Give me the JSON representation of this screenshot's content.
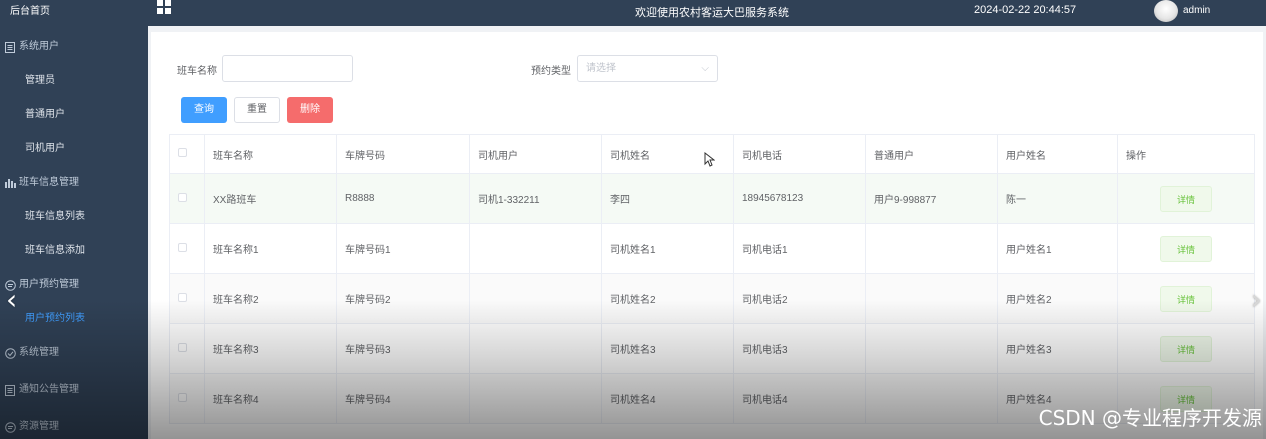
{
  "sidebar": {
    "home": "后台首页",
    "groups": [
      {
        "label": "系统用户",
        "icon": "document-icon"
      },
      {
        "label": "班车信息管理",
        "icon": "bar-chart-icon"
      },
      {
        "label": "用户预约管理",
        "icon": "chat-icon"
      },
      {
        "label": "系统管理",
        "icon": "check-circle-icon"
      },
      {
        "label": "通知公告管理",
        "icon": "document-icon"
      },
      {
        "label": "资源管理",
        "icon": "chat-icon"
      }
    ],
    "items": {
      "admin": "管理员",
      "normal_user": "普通用户",
      "driver_user": "司机用户",
      "bus_list": "班车信息列表",
      "bus_add": "班车信息添加",
      "booking_list": "用户预约列表"
    },
    "active_color": "#409eff"
  },
  "header": {
    "title": "欢迎使用农村客运大巴服务系统",
    "datetime": "2024-02-22 20:44:57",
    "username": "admin"
  },
  "filters": {
    "bus_name_label": "班车名称",
    "bus_name_value": "",
    "booking_type_label": "预约类型",
    "booking_type_placeholder": "请选择"
  },
  "buttons": {
    "query": "查询",
    "reset": "重置",
    "delete": "删除"
  },
  "table": {
    "columns": [
      "班车名称",
      "车牌号码",
      "司机用户",
      "司机姓名",
      "司机电话",
      "普通用户",
      "用户姓名",
      "操作"
    ],
    "detail_label": "详情",
    "rows": [
      [
        "XX路班车",
        "R8888",
        "司机1-332211",
        "李四",
        "18945678123",
        "用户9-998877",
        "陈一"
      ],
      [
        "班车名称1",
        "车牌号码1",
        "",
        "司机姓名1",
        "司机电话1",
        "",
        "用户姓名1"
      ],
      [
        "班车名称2",
        "车牌号码2",
        "",
        "司机姓名2",
        "司机电话2",
        "",
        "用户姓名2"
      ],
      [
        "班车名称3",
        "车牌号码3",
        "",
        "司机姓名3",
        "司机电话3",
        "",
        "用户姓名3"
      ],
      [
        "班车名称4",
        "车牌号码4",
        "",
        "司机姓名4",
        "司机电话4",
        "",
        "用户姓名4"
      ]
    ]
  },
  "watermark": "CSDN @专业程序开发源",
  "colors": {
    "sidebar_bg": "#304156",
    "primary": "#409eff",
    "danger": "#f56c6c",
    "success": "#67c23a"
  }
}
